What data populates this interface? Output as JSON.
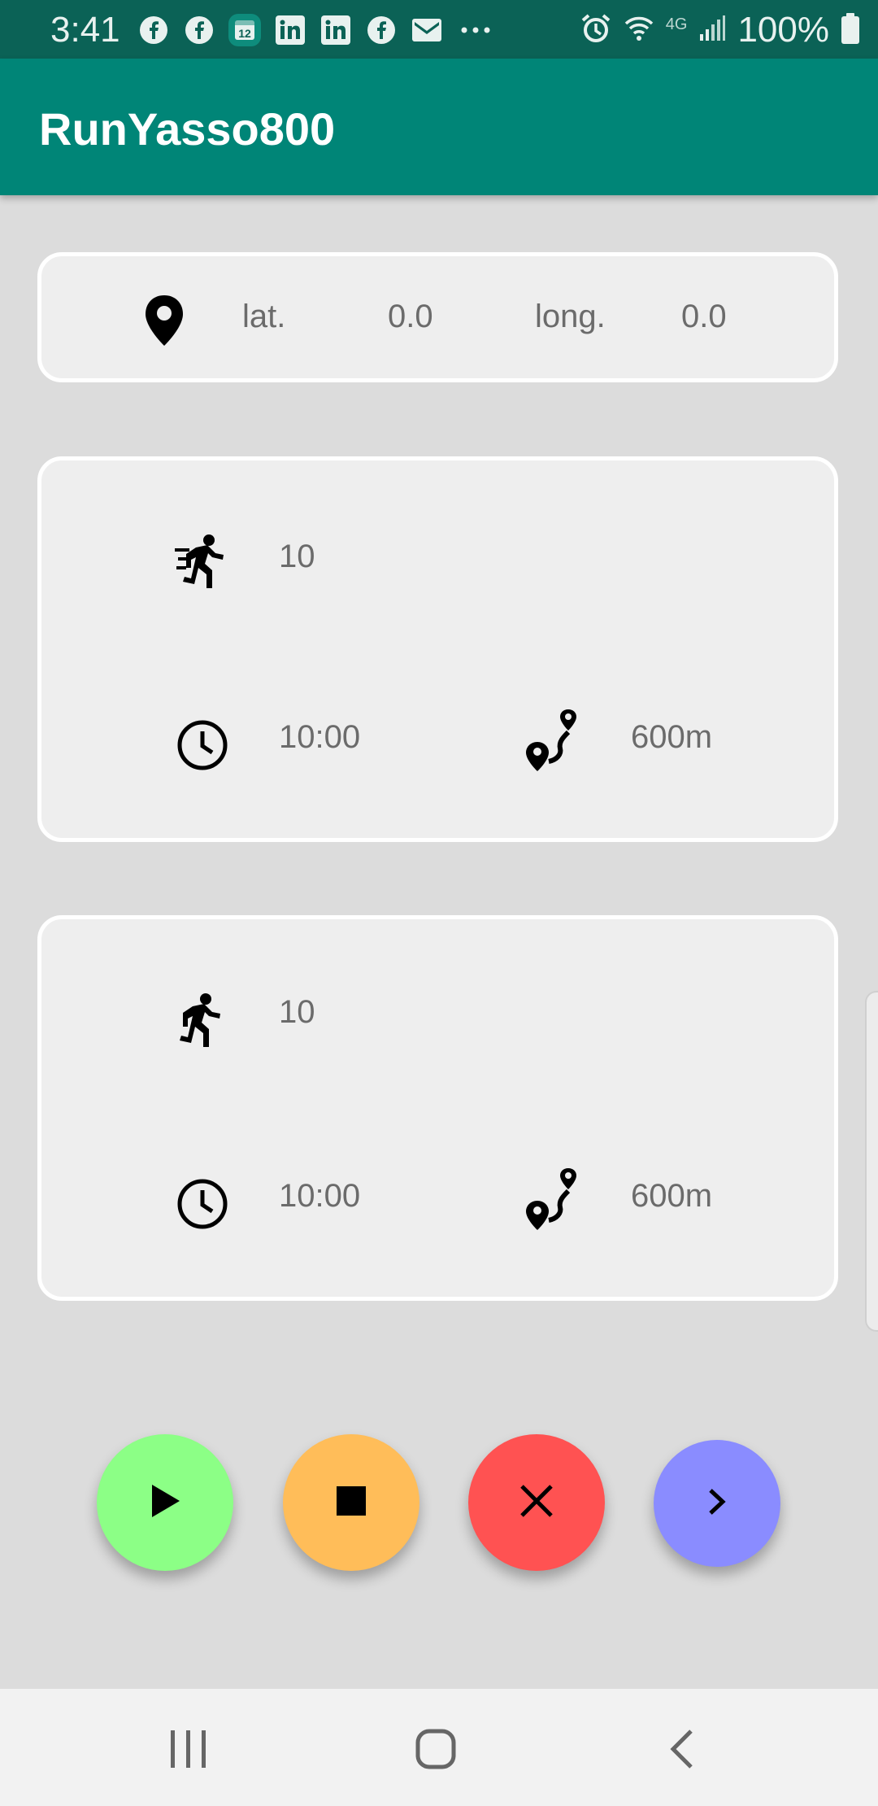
{
  "status_bar": {
    "time": "3:41",
    "battery": "100%",
    "network": "4G",
    "notification_icons": [
      "facebook-icon",
      "facebook-icon",
      "calendar-icon",
      "linkedin-icon",
      "linkedin-icon",
      "facebook-icon",
      "gmail-icon",
      "more-icon"
    ],
    "calendar_day": "12"
  },
  "app_bar": {
    "title": "RunYasso800",
    "color": "#008577"
  },
  "location": {
    "icon": "location-pin-icon",
    "lat_label": "lat.",
    "lat_value": "0.0",
    "long_label": "long.",
    "long_value": "0.0"
  },
  "interval_cards": [
    {
      "mode_icon": "run-fast-icon",
      "count": "10",
      "time": "10:00",
      "distance": "600m"
    },
    {
      "mode_icon": "run-icon",
      "count": "10",
      "time": "10:00",
      "distance": "600m"
    }
  ],
  "controls": {
    "play": {
      "icon": "play-icon",
      "color": "#8cff86"
    },
    "stop": {
      "icon": "stop-icon",
      "color": "#ffbd59"
    },
    "cancel": {
      "icon": "close-icon",
      "color": "#ff5252"
    },
    "next": {
      "icon": "chevron-right-icon",
      "color": "#8a8cff"
    }
  },
  "nav_bar": {
    "items": [
      "recent-apps-icon",
      "home-icon",
      "back-icon"
    ]
  }
}
